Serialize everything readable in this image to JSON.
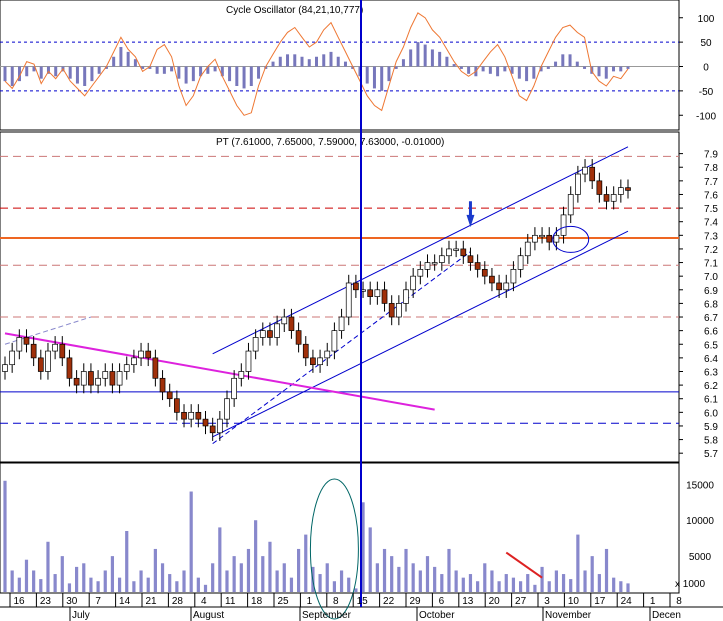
{
  "oscillator_panel": {
    "title": "Cycle Oscillator (84,21,10,777)",
    "yticks": [
      100,
      50,
      0,
      -50,
      -100
    ]
  },
  "price_panel": {
    "title": "PT (7.61000, 7.65000, 7.59000, 7.63000, -0.01000)",
    "yticks": [
      "7.9",
      "7.8",
      "7.7",
      "7.6",
      "7.5",
      "7.4",
      "7.3",
      "7.2",
      "7.1",
      "7.0",
      "6.9",
      "6.8",
      "6.7",
      "6.6",
      "6.5",
      "6.4",
      "6.3",
      "6.2",
      "6.1",
      "6.0",
      "5.9",
      "5.8",
      "5.7"
    ]
  },
  "volume_panel": {
    "yticks": [
      "15000",
      "10000",
      "5000"
    ],
    "multiplier_label": "x 1000"
  },
  "x_axis": {
    "day_labels": [
      "16",
      "23",
      "30",
      "7",
      "14",
      "21",
      "28",
      "4",
      "11",
      "18",
      "25",
      "1",
      "8",
      "15",
      "22",
      "29",
      "6",
      "13",
      "20",
      "27",
      "3",
      "10",
      "17",
      "24",
      "1",
      "8"
    ],
    "month_labels": [
      "July",
      "August",
      "September",
      "October",
      "November",
      "Decen"
    ]
  },
  "colors": {
    "up_candle": "#ffffff",
    "down_candle": "#a0300a",
    "channel": "#0000cc",
    "trendline_magenta": "#dd22dd",
    "horizontal_orange": "#ee6622",
    "dashed_red": "#cc0000",
    "oscillator_line": "#ee7733",
    "histogram": "#7777bb",
    "volume_bars": "#8888cc",
    "cursor_line": "#0000cc"
  },
  "chart_data": [
    {
      "type": "line",
      "title": "Cycle Oscillator (84,21,10,777)",
      "ylim": [
        -120,
        120
      ],
      "reference_levels": [
        50,
        0,
        -50
      ],
      "oscillator": [
        -30,
        -45,
        -20,
        10,
        5,
        -35,
        -10,
        -25,
        -5,
        -30,
        -45,
        -60,
        -40,
        -20,
        0,
        30,
        60,
        35,
        20,
        -10,
        0,
        35,
        45,
        20,
        -40,
        -80,
        -60,
        -20,
        0,
        15,
        -20,
        -50,
        -80,
        -100,
        -95,
        -40,
        0,
        25,
        50,
        70,
        80,
        60,
        40,
        50,
        75,
        90,
        60,
        30,
        0,
        -30,
        -60,
        -80,
        -90,
        -40,
        10,
        40,
        80,
        110,
        100,
        75,
        60,
        35,
        10,
        -10,
        -20,
        -10,
        10,
        30,
        45,
        20,
        -20,
        -60,
        -70,
        -40,
        0,
        30,
        60,
        80,
        85,
        70,
        60,
        -10,
        -30,
        -40,
        -20,
        -25,
        -5
      ],
      "histogram": [
        -30,
        -40,
        -30,
        -20,
        -10,
        -25,
        -15,
        -20,
        -10,
        -25,
        -35,
        -40,
        -30,
        -15,
        -5,
        20,
        40,
        30,
        15,
        -5,
        -5,
        -15,
        -15,
        -10,
        -25,
        -35,
        -30,
        -20,
        -15,
        -10,
        -20,
        -30,
        -40,
        -45,
        -40,
        -25,
        -5,
        10,
        20,
        25,
        25,
        20,
        15,
        20,
        25,
        30,
        20,
        10,
        -5,
        -20,
        -35,
        -45,
        -50,
        -30,
        -5,
        15,
        35,
        50,
        45,
        35,
        30,
        20,
        5,
        -5,
        -15,
        -20,
        -10,
        -15,
        -20,
        -10,
        -15,
        -25,
        -30,
        -25,
        -10,
        -5,
        10,
        25,
        25,
        10,
        -5,
        -15,
        -20,
        -25,
        -10,
        -10,
        -5
      ],
      "cursor_date": "2005-09-15"
    },
    {
      "type": "candlestick",
      "title": "PT (7.61000, 7.65000, 7.59000, 7.63000, -0.01000)",
      "ylim": [
        5.65,
        8.0
      ],
      "last": {
        "open": 7.61,
        "high": 7.65,
        "low": 7.59,
        "close": 7.63,
        "change": -0.01
      },
      "horizontal_levels": [
        {
          "value": 7.28,
          "style": "solid",
          "color": "#ee6622"
        },
        {
          "value": 7.5,
          "style": "dashed",
          "color": "#cc0000"
        },
        {
          "value": 5.92,
          "style": "dashed",
          "color": "#0000cc"
        },
        {
          "value": 6.15,
          "style": "solid",
          "color": "#0000cc"
        },
        {
          "value": 7.88,
          "style": "dashed",
          "color": "#cc7777"
        },
        {
          "value": 6.7,
          "style": "dashed",
          "color": "#cc7777"
        },
        {
          "value": 7.08,
          "style": "dashed",
          "color": "#cc7777"
        }
      ],
      "closes": [
        6.35,
        6.45,
        6.55,
        6.5,
        6.4,
        6.3,
        6.45,
        6.5,
        6.4,
        6.25,
        6.2,
        6.3,
        6.2,
        6.25,
        6.3,
        6.2,
        6.3,
        6.35,
        6.4,
        6.45,
        6.4,
        6.25,
        6.15,
        6.1,
        6.0,
        5.95,
        6.0,
        5.95,
        5.9,
        5.85,
        5.95,
        6.1,
        6.25,
        6.3,
        6.45,
        6.55,
        6.6,
        6.55,
        6.65,
        6.7,
        6.6,
        6.5,
        6.4,
        6.35,
        6.4,
        6.45,
        6.6,
        6.7,
        6.95,
        6.9,
        6.9,
        6.85,
        6.9,
        6.8,
        6.7,
        6.8,
        6.9,
        7.0,
        7.05,
        7.1,
        7.1,
        7.15,
        7.2,
        7.2,
        7.15,
        7.1,
        7.05,
        7.0,
        6.95,
        6.9,
        6.95,
        7.05,
        7.15,
        7.25,
        7.3,
        7.3,
        7.25,
        7.3,
        7.45,
        7.6,
        7.75,
        7.8,
        7.7,
        7.6,
        7.55,
        7.6,
        7.65,
        7.63
      ],
      "annotation_arrow_date": "2005-10-11"
    },
    {
      "type": "bar",
      "title": "",
      "ylabel": "x 1000",
      "ylim": [
        0,
        17000
      ],
      "values": [
        15500,
        3000,
        2000,
        4500,
        3000,
        1800,
        7000,
        2500,
        5000,
        1200,
        3500,
        4000,
        2000,
        1500,
        3000,
        5000,
        2000,
        8500,
        1500,
        3000,
        2000,
        6000,
        4000,
        2500,
        1500,
        3000,
        14000,
        2000,
        1000,
        4000,
        9000,
        3000,
        5000,
        4000,
        6000,
        10000,
        5000,
        7000,
        3000,
        4000,
        2000,
        6000,
        8000,
        3500,
        2500,
        4000,
        1500,
        3000,
        2000,
        500,
        12500,
        9000,
        4000,
        6000,
        5000,
        3500,
        6000,
        4000,
        3000,
        5000,
        3500,
        2500,
        6000,
        3000,
        2000,
        2500,
        1500,
        4000,
        3000,
        1500,
        2500,
        2000,
        1500,
        2500,
        1000,
        3500,
        1500,
        3000,
        2500,
        1800,
        8000,
        3000,
        5000,
        2500,
        6000,
        2000,
        1500,
        1200
      ],
      "annotation_line_note": "declining volume"
    }
  ]
}
